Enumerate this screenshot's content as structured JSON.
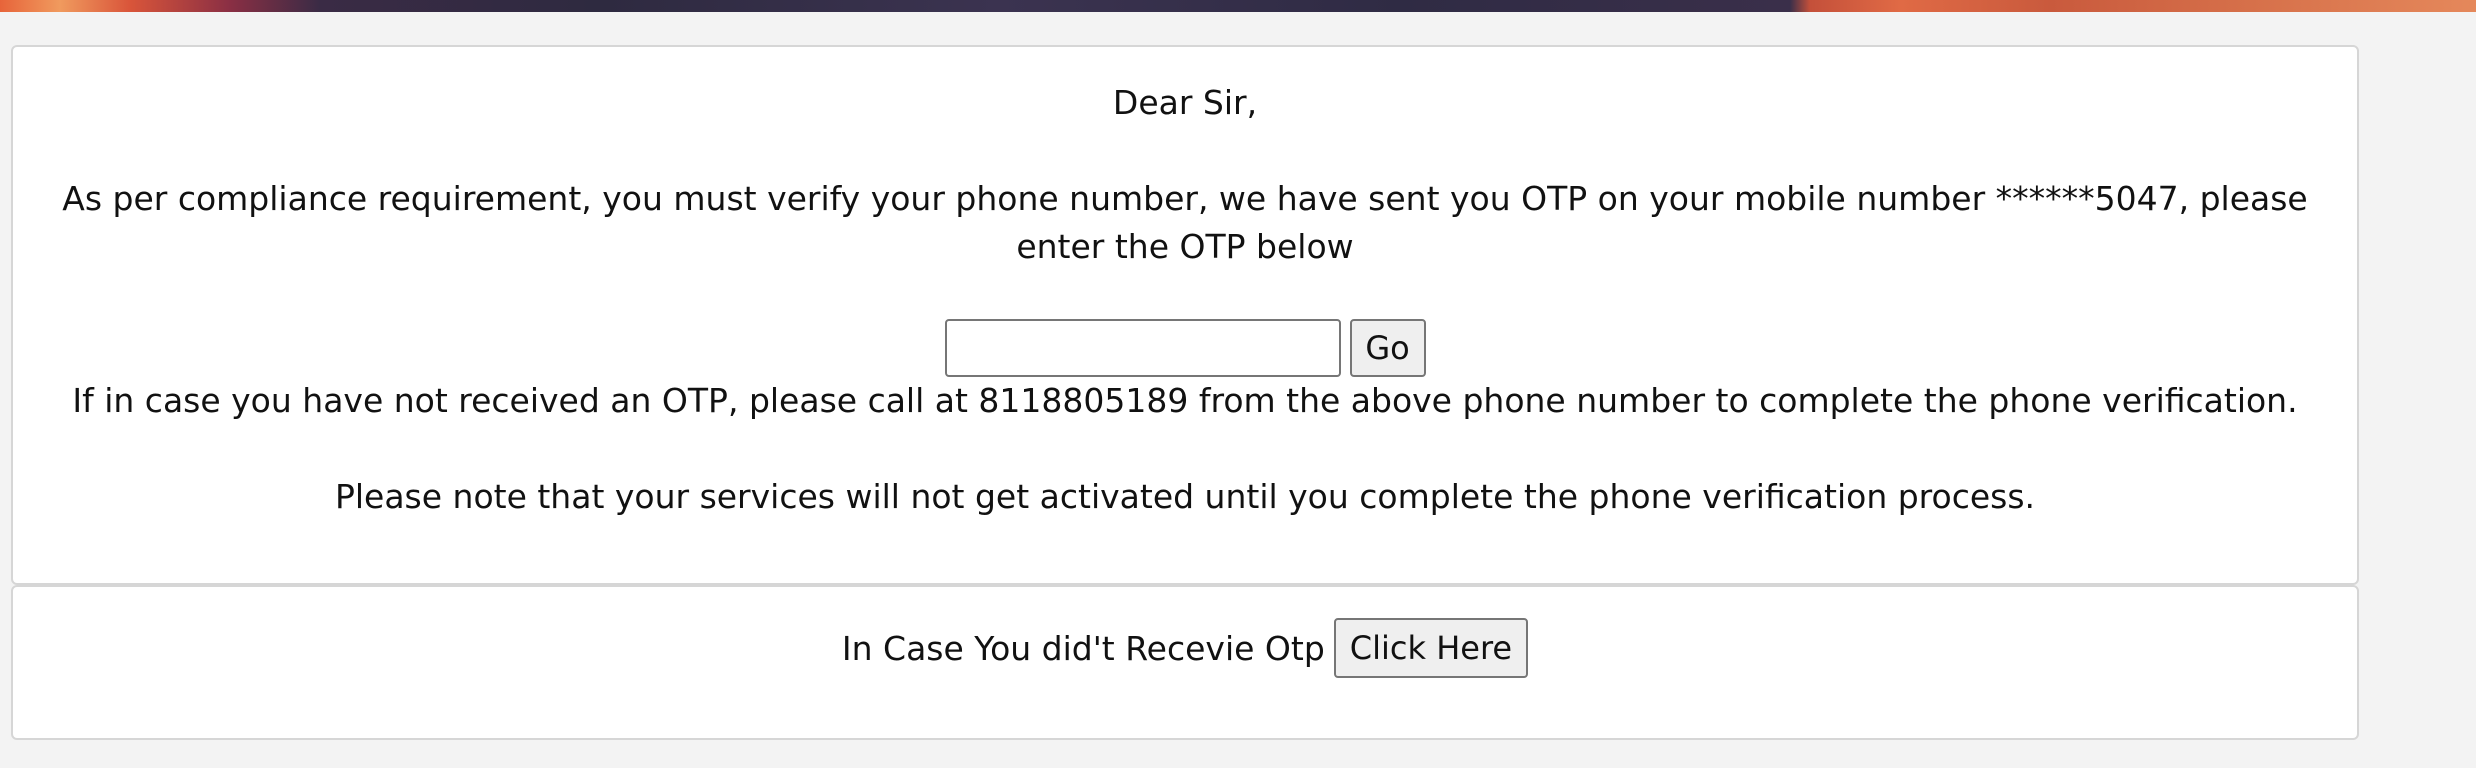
{
  "notice": {
    "greeting": "Dear Sir,",
    "compliance_message": "As per compliance requirement, you must verify your phone number, we have sent you OTP on your mobile number ******5047, please enter the OTP below",
    "otp_input": {
      "value": "",
      "placeholder": ""
    },
    "go_label": "Go",
    "call_message": "If in case you have not received an OTP, please call at 8118805189 from the above phone number to complete the phone verification.",
    "activation_note": "Please note that your services will not get activated until you complete the phone verification process."
  },
  "retry": {
    "prompt": "In Case You did't Recevie Otp",
    "button_label": "Click Here"
  }
}
